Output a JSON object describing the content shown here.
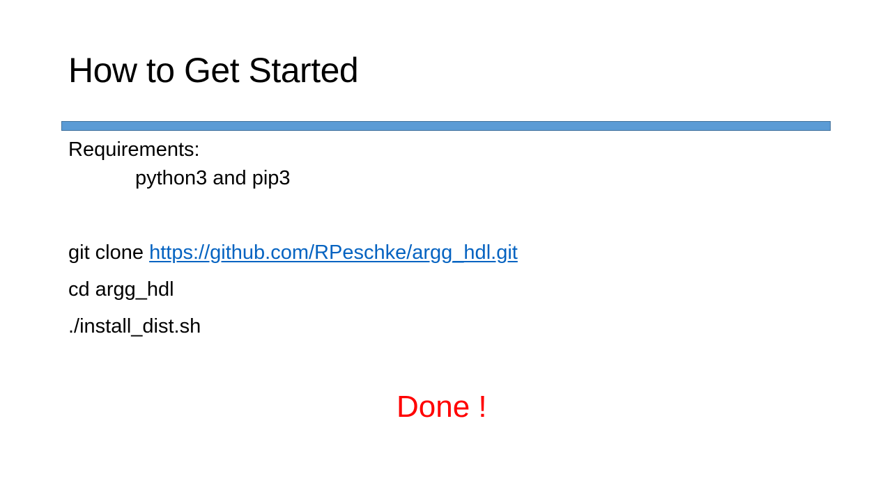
{
  "slide": {
    "title": "How to Get Started",
    "accent_color": "#5b9bd5"
  },
  "requirements": {
    "heading": "Requirements:",
    "item": "python3 and pip3"
  },
  "commands": {
    "clone_prefix": "git clone",
    "clone_url": "https://github.com/RPeschke/argg_hdl.git",
    "cd": "cd argg_hdl",
    "install": "./install_dist.sh"
  },
  "done": {
    "text": "Done !",
    "color": "#ff0000"
  }
}
